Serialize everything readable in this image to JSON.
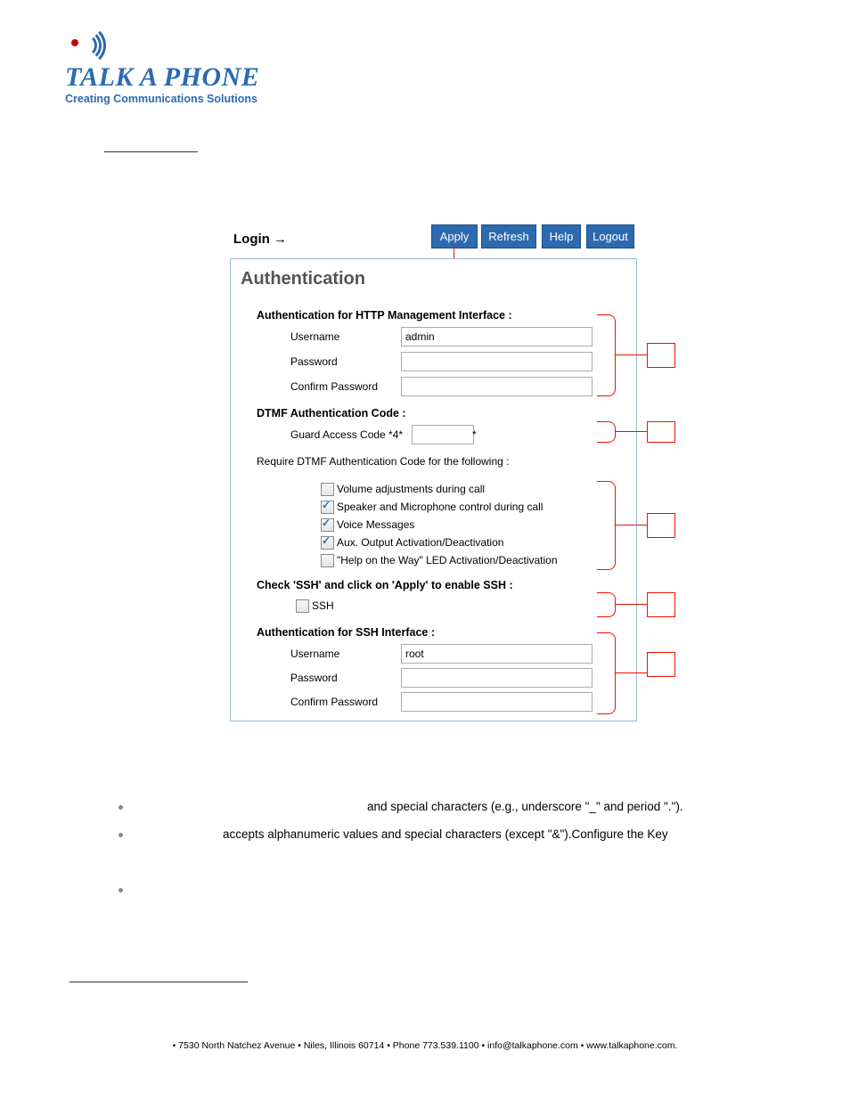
{
  "logo": {
    "text": "TALK A PHONE",
    "tagline": "Creating Communications Solutions"
  },
  "login_line": "Login →",
  "toolbar": {
    "apply": "Apply",
    "refresh": "Refresh",
    "help": "Help",
    "logout": "Logout"
  },
  "panel": {
    "title": "Authentication",
    "http": {
      "heading": "Authentication for HTTP Management Interface :",
      "username_label": "Username",
      "username_value": "admin",
      "password_label": "Password",
      "confirm_label": "Confirm Password"
    },
    "dtmf": {
      "heading": "DTMF Authentication Code :",
      "guard_label": "Guard Access Code  *4*",
      "guard_suffix": "*",
      "require_text": "Require DTMF Authentication Code for the following :",
      "items": [
        {
          "label": "Volume adjustments during call",
          "checked": false
        },
        {
          "label": "Speaker and Microphone control during call",
          "checked": true
        },
        {
          "label": "Voice Messages",
          "checked": true
        },
        {
          "label": "Aux. Output Activation/Deactivation",
          "checked": true
        },
        {
          "label": "\"Help on the Way\" LED Activation/Deactivation",
          "checked": false
        }
      ]
    },
    "ssh_enable": {
      "heading": "Check 'SSH' and click on 'Apply' to enable SSH :",
      "label": "SSH"
    },
    "ssh_auth": {
      "heading": "Authentication for SSH Interface :",
      "username_label": "Username",
      "username_value": "root",
      "password_label": "Password",
      "confirm_label": "Confirm Password"
    }
  },
  "bullets": {
    "b1": "and special characters (e.g., underscore \"_\" and period \".\").",
    "b2": "accepts alphanumeric values and special characters (except \"&\").Configure the Key"
  },
  "footer": "• 7530 North Natchez Avenue • Niles, Illinois 60714 • Phone 773.539.1100 • info@talkaphone.com • www.talkaphone.com."
}
